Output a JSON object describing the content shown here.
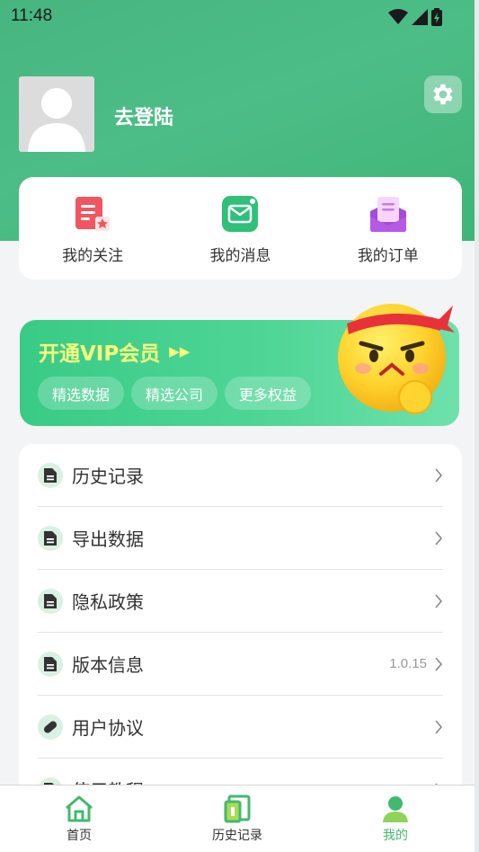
{
  "status_bar": {
    "time": "11:48"
  },
  "profile": {
    "login_text": "去登陆"
  },
  "quick_actions": [
    {
      "label": "我的关注",
      "icon": "follow-icon"
    },
    {
      "label": "我的消息",
      "icon": "message-icon"
    },
    {
      "label": "我的订单",
      "icon": "order-icon"
    }
  ],
  "vip": {
    "title": "开通VIP会员",
    "tags": [
      "精选数据",
      "精选公司",
      "更多权益"
    ]
  },
  "menu": [
    {
      "label": "历史记录",
      "value": "",
      "icon": "document-icon"
    },
    {
      "label": "导出数据",
      "value": "",
      "icon": "document-icon"
    },
    {
      "label": "隐私政策",
      "value": "",
      "icon": "document-icon"
    },
    {
      "label": "版本信息",
      "value": "1.0.15",
      "icon": "document-icon"
    },
    {
      "label": "用户协议",
      "value": "",
      "icon": "pill-icon"
    },
    {
      "label": "使用教程",
      "value": "",
      "icon": "document-icon"
    }
  ],
  "tabs": [
    {
      "label": "首页",
      "icon": "home-icon"
    },
    {
      "label": "历史记录",
      "icon": "history-icon"
    },
    {
      "label": "我的",
      "icon": "user-icon",
      "active": true
    }
  ],
  "colors": {
    "primary": "#43b96f",
    "vip_title": "#f6ff7c"
  }
}
